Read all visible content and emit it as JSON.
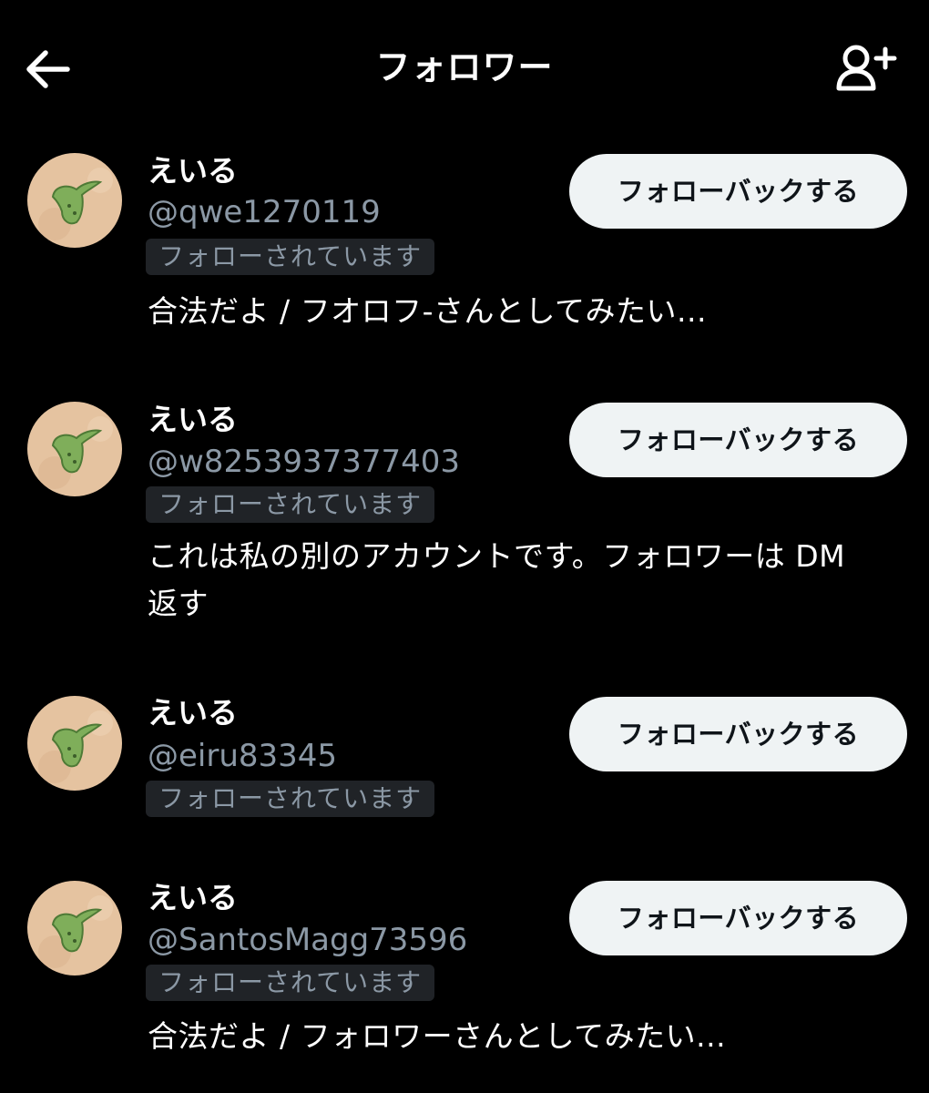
{
  "header": {
    "title": "フォロワー",
    "back_icon": "arrow-left-icon",
    "add_icon": "person-add-icon"
  },
  "followers": [
    {
      "name": "えいる",
      "handle": "@qwe1270119",
      "badge": "フォローされています",
      "bio": "合法だよ / フオロフ-さんとしてみたい...",
      "button": "フォローバックする"
    },
    {
      "name": "えいる",
      "handle": "@w8253937377403",
      "badge": "フォローされています",
      "bio": "これは私の別のアカウントです。フォロワーは DM 返す",
      "button": "フォローバックする"
    },
    {
      "name": "えいる",
      "handle": "@eiru83345",
      "badge": "フォローされています",
      "button": "フォローバックする"
    },
    {
      "name": "えいる",
      "handle": "@SantosMagg73596",
      "badge": "フォローされています",
      "bio": "合法だよ / フォロワーさんとしてみたい...",
      "button": "フォローバックする"
    }
  ],
  "colors": {
    "background": "#000000",
    "primary_text": "#ffffff",
    "secondary_text": "#8b98a5",
    "badge_bg": "#202327",
    "button_bg": "#eff3f4",
    "button_text": "#0f1419"
  }
}
